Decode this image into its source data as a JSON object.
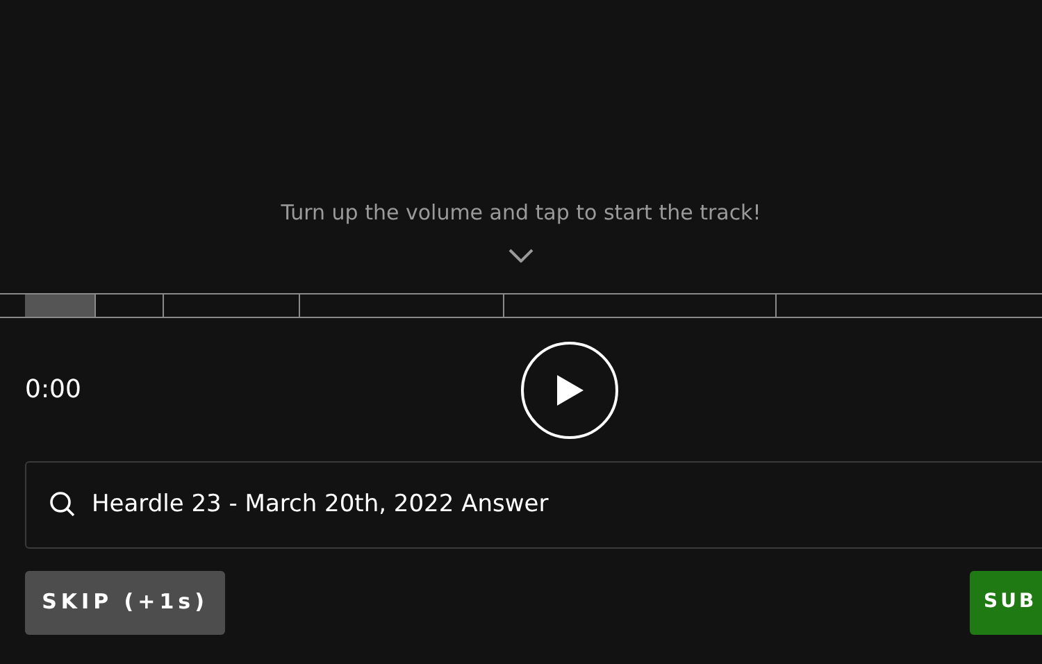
{
  "hint": "Turn up the volume and tap to start the track!",
  "segments": [
    {
      "unlocked": true
    },
    {
      "unlocked": false
    },
    {
      "unlocked": false
    },
    {
      "unlocked": false
    },
    {
      "unlocked": false
    },
    {
      "unlocked": false
    }
  ],
  "time": "0:00",
  "search": {
    "value": "Heardle 23 - March 20th, 2022 Answer"
  },
  "skip_button": "SKIP (+1s)",
  "submit_button": "SUB"
}
